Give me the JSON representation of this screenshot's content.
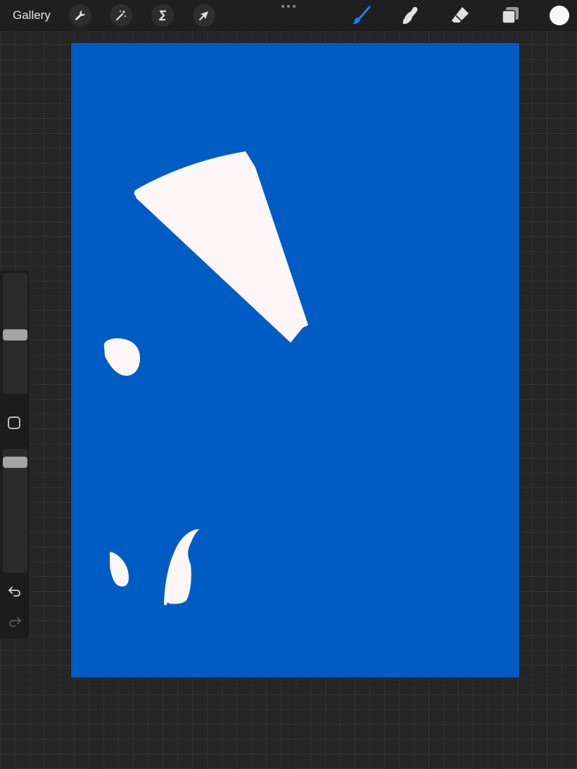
{
  "topbar": {
    "gallery_label": "Gallery",
    "left_tools": [
      {
        "name": "actions",
        "icon": "wrench-icon"
      },
      {
        "name": "adjustments",
        "icon": "magic-wand-icon"
      },
      {
        "name": "selection",
        "icon": "selection-s-icon"
      },
      {
        "name": "transform",
        "icon": "arrow-cursor-icon"
      }
    ],
    "more_icon": "ellipsis-icon",
    "right_tools": [
      {
        "name": "brush",
        "icon": "brush-icon",
        "active": true
      },
      {
        "name": "smudge",
        "icon": "smudge-finger-icon",
        "active": false
      },
      {
        "name": "eraser",
        "icon": "eraser-icon",
        "active": false
      },
      {
        "name": "layers",
        "icon": "layers-icon",
        "active": false
      }
    ],
    "current_color": "#fdf6f7"
  },
  "canvas": {
    "background_color": "#005cc5",
    "shape_color": "#fdf6f7"
  },
  "sidebar": {
    "brush_size_level": 0.49,
    "opacity_level": 0.93,
    "modify_icon": "square-modify-icon",
    "undo_icon": "undo-icon",
    "redo_icon": "redo-icon"
  },
  "colors": {
    "accent": "#1a7cf5",
    "toolbar_bg": "#1f1f1f",
    "workspace_bg": "#262626"
  }
}
